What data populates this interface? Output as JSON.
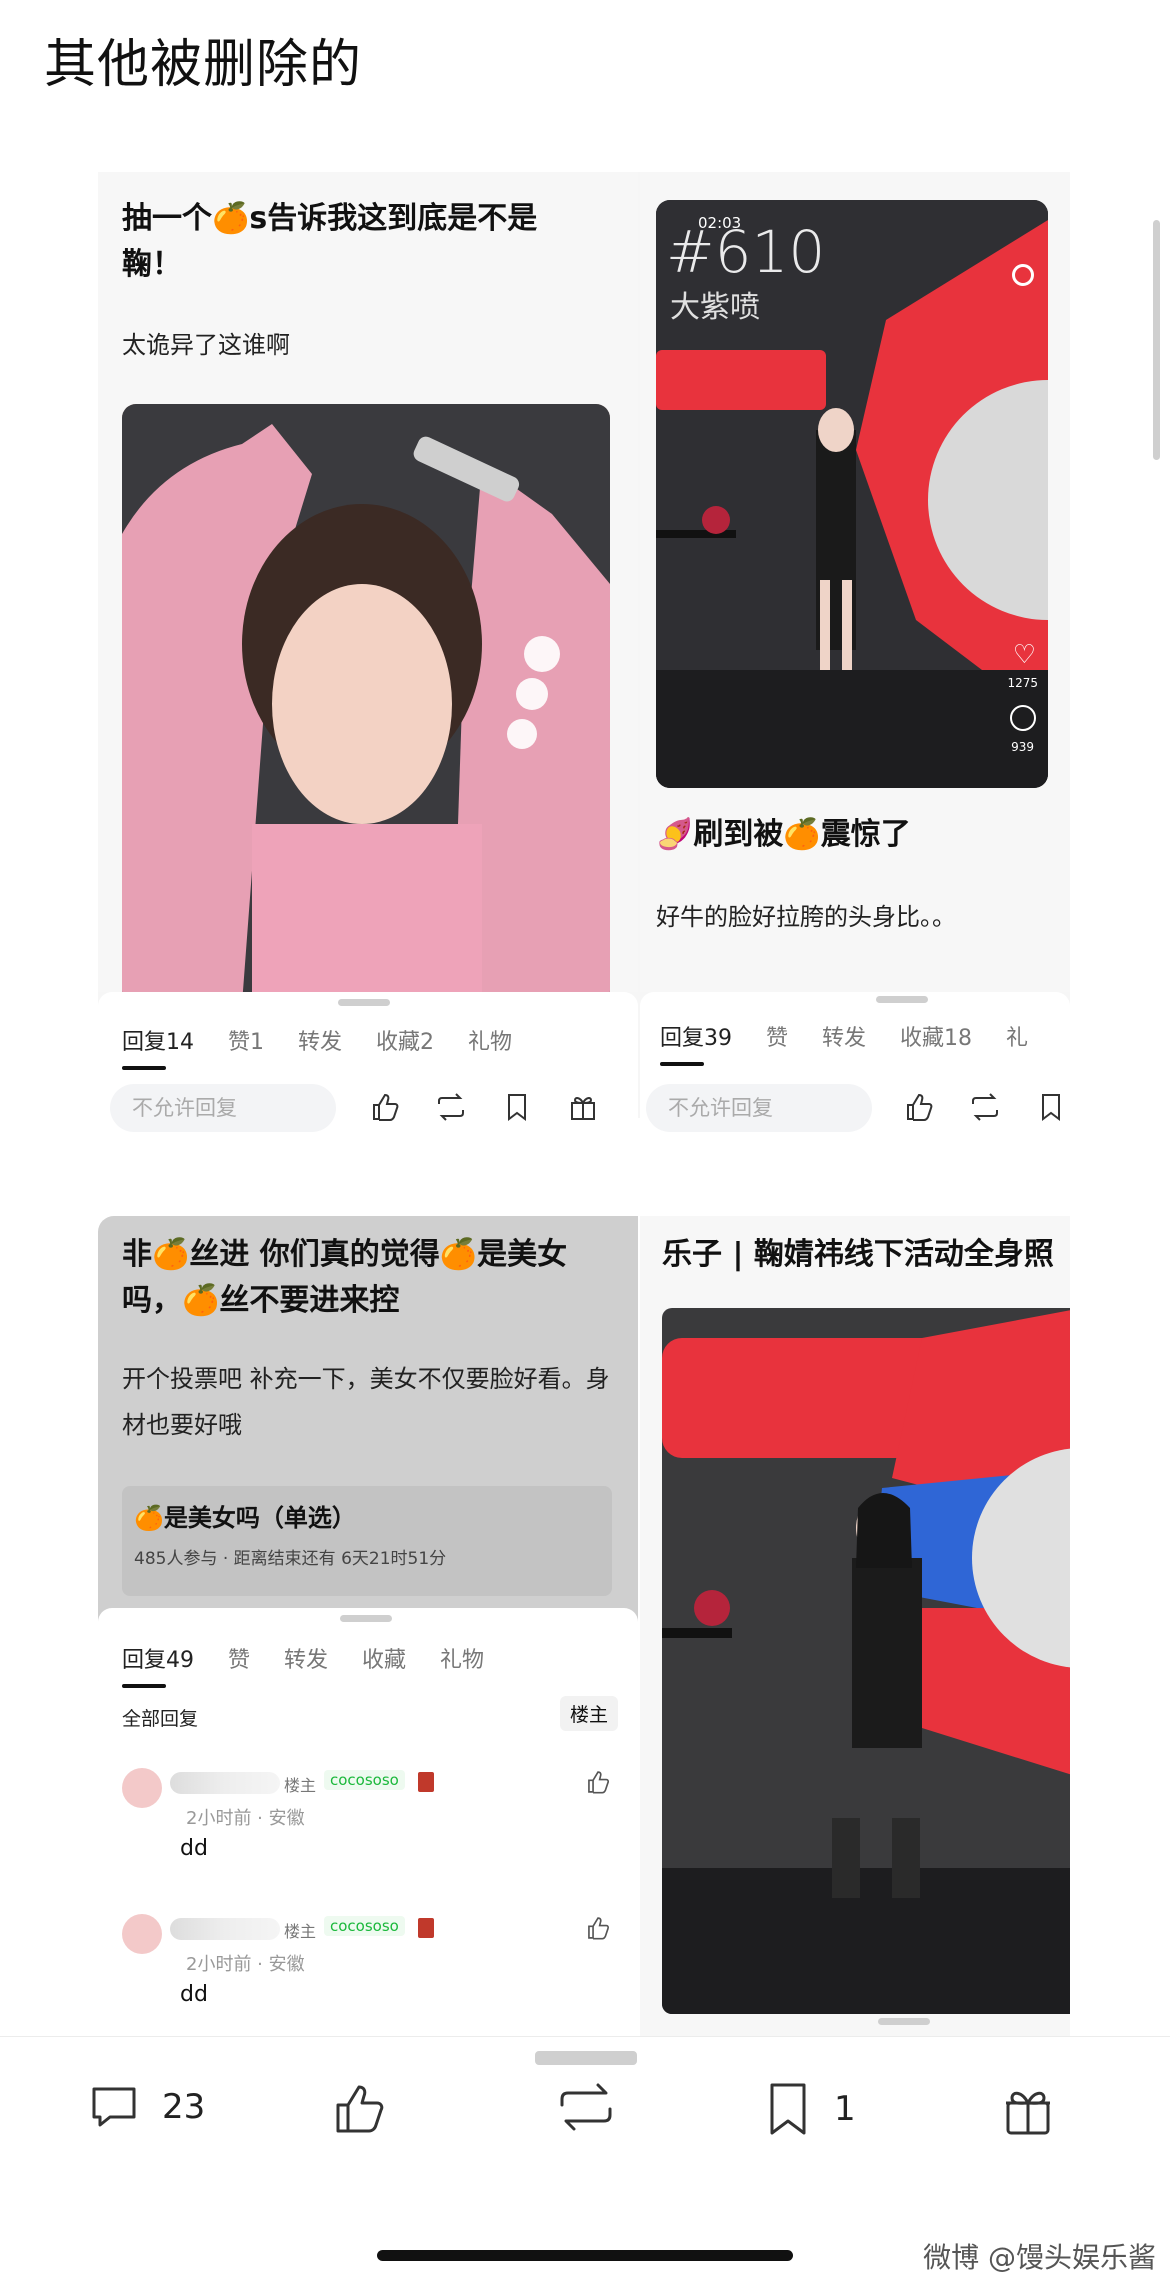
{
  "page": {
    "title": "其他被删除的"
  },
  "card1": {
    "title": "抽一个🍊s告诉我这到底是不是鞠！",
    "body": "太诡异了这谁啊",
    "tabs": [
      "回复14",
      "赞1",
      "转发",
      "收藏2",
      "礼物"
    ],
    "reply_placeholder": "不允许回复"
  },
  "card2": {
    "video": {
      "time": "02:03",
      "number": "#610",
      "subtitle": "大紫喷",
      "likes": "1275",
      "comments": "939"
    },
    "title": "🍠刷到被🍊震惊了",
    "body": "好牛的脸好拉胯的头身比。。",
    "tabs": [
      "回复39",
      "赞",
      "转发",
      "收藏18",
      "礼"
    ],
    "reply_placeholder": "不允许回复"
  },
  "card3": {
    "title": "非🍊丝进 你们真的觉得🍊是美女吗，🍊丝不要进来控",
    "body": "开个投票吧 补充一下，美女不仅要脸好看。身材也要好哦",
    "poll": {
      "title": "🍊是美女吗（单选）",
      "meta": "485人参与 · 距离结束还有 6天21时51分"
    },
    "tabs": [
      "回复49",
      "赞",
      "转发",
      "收藏",
      "礼物"
    ],
    "all_replies": "全部回复",
    "filter": "楼主",
    "comments": [
      {
        "tag": "楼主",
        "badge": "cocososo",
        "meta": "2小时前 · 安徽",
        "text": "dd"
      },
      {
        "tag": "楼主",
        "badge": "cocososo",
        "meta": "2小时前 · 安徽",
        "text": "dd"
      }
    ]
  },
  "card4": {
    "title": "乐子 | 鞠婧祎线下活动全身照"
  },
  "bottom_bar": {
    "comments": "23",
    "bookmarks": "1"
  },
  "watermark": "微博 @馒头娱乐酱",
  "colors": {
    "accent_green": "#1bb83b",
    "badge_red": "#c0392b",
    "mac_red": "#e8333d"
  }
}
